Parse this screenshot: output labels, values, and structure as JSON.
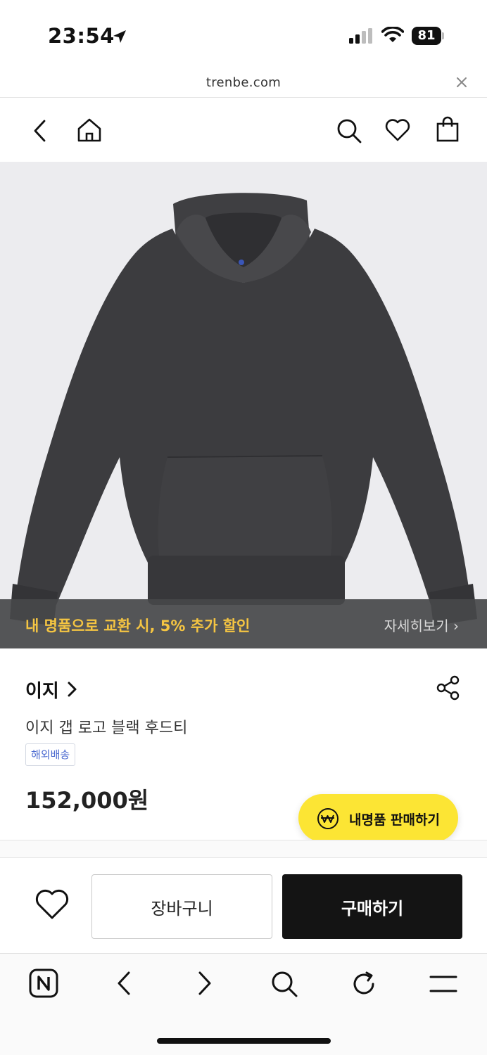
{
  "status_bar": {
    "time": "23:54",
    "battery": "81"
  },
  "url_bar": {
    "domain": "trenbe.com"
  },
  "header": {
    "icons": [
      "back-icon",
      "home-icon",
      "search-icon",
      "heart-icon",
      "shopping-bag-icon"
    ]
  },
  "product": {
    "image_subject": "dark charcoal hooded sweatshirt",
    "promo_text": "내 명품으로 교환 시, 5% 추가 할인",
    "promo_more": "자세히보기 ›",
    "brand": "이지",
    "title": "이지 갭 로고 블랙 후드티",
    "shipping_badge": "해외배송",
    "price": "152,000원"
  },
  "sell_button": {
    "label": "내명품 판매하기"
  },
  "actions": {
    "cart_label": "장바구니",
    "buy_label": "구매하기"
  },
  "browser_bar": {
    "icons": [
      "naver-n-icon",
      "browser-back-icon",
      "browser-forward-icon",
      "browser-search-icon",
      "refresh-icon",
      "menu-icon"
    ]
  },
  "colors": {
    "promo_text": "#f5c542",
    "sell_button": "#fce534",
    "buy_button": "#141414",
    "badge_text": "#4d6bd0"
  }
}
